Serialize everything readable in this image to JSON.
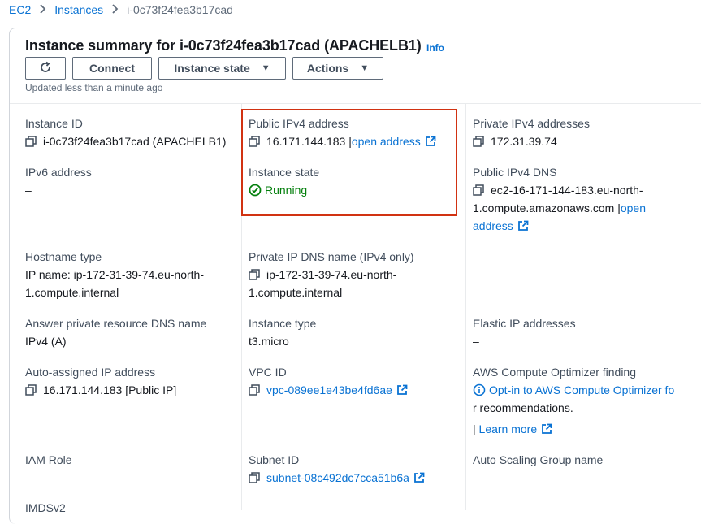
{
  "breadcrumb": {
    "items": [
      "EC2",
      "Instances"
    ],
    "current": "i-0c73f24fea3b17cad"
  },
  "header": {
    "title": "Instance summary for i-0c73f24fea3b17cad (APACHELB1)",
    "info_label": "Info",
    "updated_text": "Updated less than a minute ago"
  },
  "toolbar": {
    "refresh_icon": "refresh-icon",
    "connect_label": "Connect",
    "instance_state_label": "Instance state",
    "actions_label": "Actions"
  },
  "details": {
    "instance_id": {
      "label": "Instance ID",
      "value": "i-0c73f24fea3b17cad (APACHELB1)"
    },
    "public_ipv4": {
      "label": "Public IPv4 address",
      "value": "16.171.144.183",
      "link": "open address"
    },
    "private_ipv4": {
      "label": "Private IPv4 addresses",
      "value": "172.31.39.74"
    },
    "ipv6": {
      "label": "IPv6 address",
      "value": "–"
    },
    "instance_state": {
      "label": "Instance state",
      "value": "Running"
    },
    "public_dns": {
      "label": "Public IPv4 DNS",
      "value_line1": "ec2-16-171-144-183.eu-north-",
      "value_line2": "1.compute.amazonaws.com",
      "link_part1": "open",
      "link_part2": "address"
    },
    "hostname_type": {
      "label": "Hostname type",
      "value_line1": "IP name: ip-172-31-39-74.eu-north-",
      "value_line2": "1.compute.internal"
    },
    "private_dns": {
      "label": "Private IP DNS name (IPv4 only)",
      "value_line1": "ip-172-31-39-74.eu-north-",
      "value_line2": "1.compute.internal"
    },
    "answer_dns": {
      "label": "Answer private resource DNS name",
      "value": "IPv4 (A)"
    },
    "instance_type": {
      "label": "Instance type",
      "value": "t3.micro"
    },
    "elastic_ip": {
      "label": "Elastic IP addresses",
      "value": "–"
    },
    "auto_ip": {
      "label": "Auto-assigned IP address",
      "value": "16.171.144.183 [Public IP]"
    },
    "vpc_id": {
      "label": "VPC ID",
      "value": "vpc-089ee1e43be4fd6ae"
    },
    "optimizer": {
      "label": "AWS Compute Optimizer finding",
      "link_line1": "Opt-in to AWS Compute Optimizer fo",
      "link_line2": "r recommendations.",
      "learn_more": "Learn more"
    },
    "iam_role": {
      "label": "IAM Role",
      "value": "–"
    },
    "subnet_id": {
      "label": "Subnet ID",
      "value": "subnet-08c492dc7cca51b6a"
    },
    "asg_name": {
      "label": "Auto Scaling Group name",
      "value": "–"
    },
    "imdsv2": {
      "label": "IMDSv2"
    }
  },
  "colors": {
    "link": "#0972d3",
    "running": "#037f0c",
    "highlight_border": "#d13212",
    "label": "#414d5c"
  }
}
